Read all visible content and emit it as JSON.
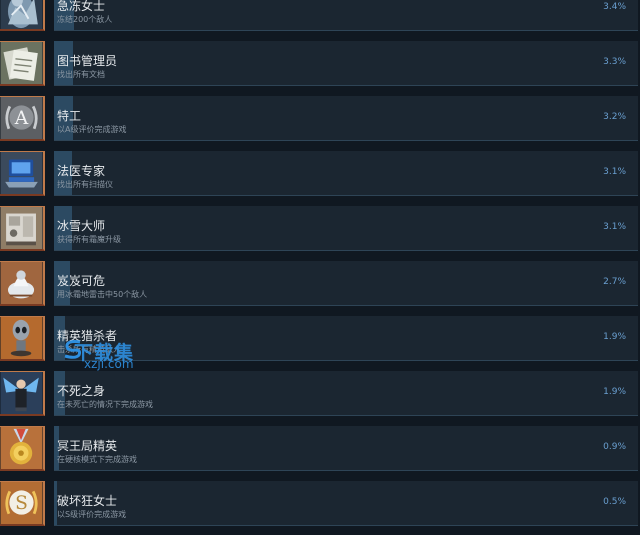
{
  "achievements": [
    {
      "title": "急冻女士",
      "desc": "冻结200个敌人",
      "percent": "3.4%",
      "fill_pct": 3.4,
      "icon": "frozen-figure-icon"
    },
    {
      "title": "图书管理员",
      "desc": "找出所有文档",
      "percent": "3.3%",
      "fill_pct": 3.3,
      "icon": "documents-icon"
    },
    {
      "title": "特工",
      "desc": "以A级评价完成游戏",
      "percent": "3.2%",
      "fill_pct": 3.2,
      "icon": "grade-a-laurel-icon"
    },
    {
      "title": "法医专家",
      "desc": "找出所有扫描仪",
      "percent": "3.1%",
      "fill_pct": 3.1,
      "icon": "scanner-laptop-icon"
    },
    {
      "title": "冰雪大师",
      "desc": "获得所有霜魔升级",
      "percent": "3.1%",
      "fill_pct": 3.1,
      "icon": "machine-icon"
    },
    {
      "title": "岌岌可危",
      "desc": "用冰霜地雷击中50个敌人",
      "percent": "2.7%",
      "fill_pct": 2.7,
      "icon": "frost-mine-icon"
    },
    {
      "title": "精英猎杀者",
      "desc": "击杀所有精英敌人",
      "percent": "1.9%",
      "fill_pct": 1.9,
      "icon": "alien-figure-icon"
    },
    {
      "title": "不死之身",
      "desc": "在未死亡的情况下完成游戏",
      "percent": "1.9%",
      "fill_pct": 1.9,
      "icon": "winged-hero-icon"
    },
    {
      "title": "冥王局精英",
      "desc": "在硬核模式下完成游戏",
      "percent": "0.9%",
      "fill_pct": 0.9,
      "icon": "gold-medal-icon"
    },
    {
      "title": "破坏狂女士",
      "desc": "以S级评价完成游戏",
      "percent": "0.5%",
      "fill_pct": 0.5,
      "icon": "grade-s-laurel-icon"
    }
  ],
  "watermark": {
    "site_cn": "下载集",
    "site_url": "xzji.com"
  }
}
